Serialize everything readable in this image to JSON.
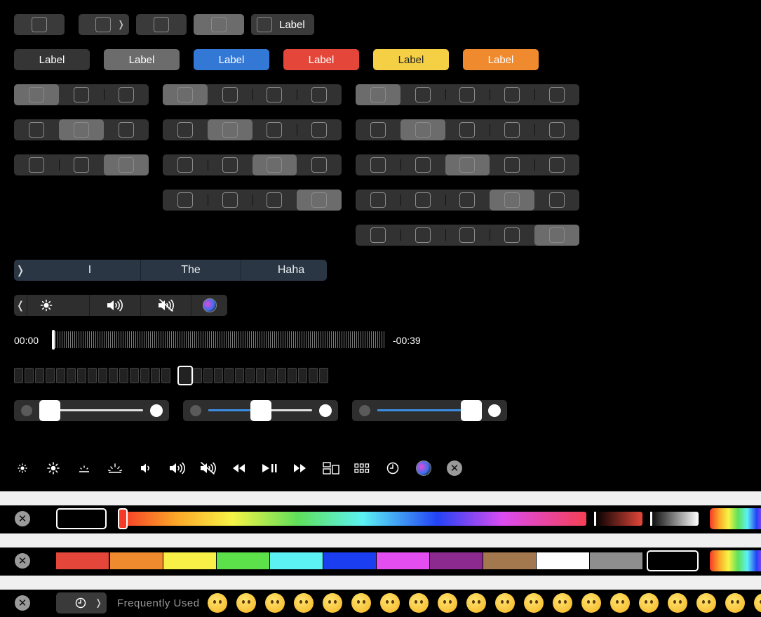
{
  "row1": {
    "label_button": "Label"
  },
  "row2": {
    "buttons": [
      {
        "label": "Label",
        "color": "#353535"
      },
      {
        "label": "Label",
        "color": "#6c6c6c"
      },
      {
        "label": "Label",
        "color": "#3478d6"
      },
      {
        "label": "Label",
        "color": "#e4473a"
      },
      {
        "label": "Label",
        "color": "#f5cf44"
      },
      {
        "label": "Label",
        "color": "#ef8a2e"
      }
    ]
  },
  "suggestions": {
    "words": [
      "I",
      "The",
      "Haha"
    ]
  },
  "control_strip": {
    "items": [
      "collapse-chevron",
      "brightness-icon",
      "volume-icon",
      "mute-icon",
      "siri-icon"
    ]
  },
  "scrubber": {
    "elapsed": "00:00",
    "remaining": "-00:39",
    "progress": 0.0
  },
  "sliders": [
    {
      "value": 0.0
    },
    {
      "value": 0.5
    },
    {
      "value": 1.0
    }
  ],
  "icon_row": [
    "brightness-low-icon",
    "brightness-high-icon",
    "keyboard-brightness-low-icon",
    "keyboard-brightness-high-icon",
    "volume-down-icon",
    "volume-up-icon",
    "mute-icon",
    "rewind-icon",
    "play-pause-icon",
    "fast-forward-icon",
    "mission-control-icon",
    "launchpad-icon",
    "screensaver-icon",
    "siri-icon",
    "close-icon"
  ],
  "color_picker": {
    "hue_slider_value": 0.0,
    "swatches": [
      "#e4473a",
      "#ef8a2e",
      "#f9f047",
      "#5ce14a",
      "#5cf2f3",
      "#1b3ef0",
      "#e24ef0",
      "#8d2a8f",
      "#a3784f",
      "#ffffff",
      "#8e8e8e"
    ]
  },
  "emoji_bar": {
    "category_label": "Frequently Used"
  }
}
